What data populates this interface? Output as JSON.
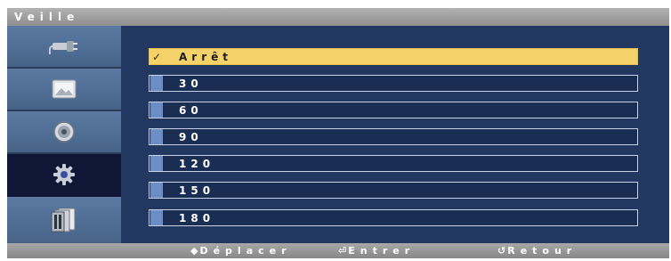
{
  "menu": {
    "title": "Veille"
  },
  "sidebar": {
    "items": [
      {
        "name": "sidebar-item-input",
        "icon": "input-plug-icon",
        "active": false
      },
      {
        "name": "sidebar-item-picture",
        "icon": "picture-icon",
        "active": false
      },
      {
        "name": "sidebar-item-sound",
        "icon": "speaker-icon",
        "active": false
      },
      {
        "name": "sidebar-item-setup",
        "icon": "gear-icon",
        "active": true
      },
      {
        "name": "sidebar-item-multi-window",
        "icon": "multi-window-icon",
        "active": false
      }
    ]
  },
  "options": {
    "items": [
      {
        "label": "Arrêt",
        "selected": true,
        "check": "✓"
      },
      {
        "label": "30",
        "selected": false
      },
      {
        "label": "60",
        "selected": false
      },
      {
        "label": "90",
        "selected": false
      },
      {
        "label": "120",
        "selected": false
      },
      {
        "label": "150",
        "selected": false
      },
      {
        "label": "180",
        "selected": false
      }
    ]
  },
  "footer": {
    "move_icon": "◆",
    "move_label": "Déplacer",
    "enter_icon": "⏎",
    "enter_label": "Entrer",
    "return_icon": "↺",
    "return_label": "Retour"
  },
  "colors": {
    "accent": "#f6d36a",
    "panel": "#233860",
    "sidebar": "#4d6b93",
    "active_item": "#101636"
  }
}
